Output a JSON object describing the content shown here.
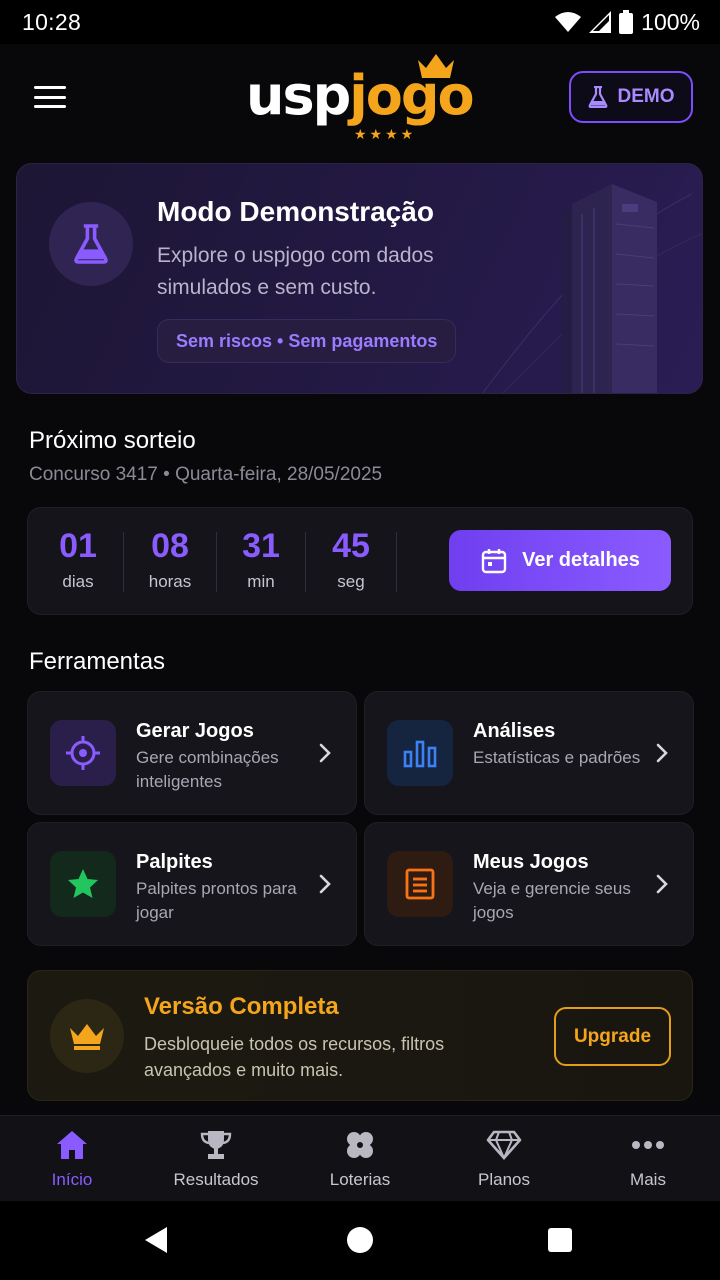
{
  "status": {
    "time": "10:28",
    "battery": "100%"
  },
  "header": {
    "logo_white": "usp",
    "logo_orange": "jogo",
    "demo_label": "DEMO"
  },
  "demo_card": {
    "title": "Modo Demonstração",
    "description": "Explore o uspjogo com dados simulados e sem custo.",
    "chip": "Sem riscos • Sem pagamentos"
  },
  "next_draw": {
    "title": "Próximo sorteio",
    "subtitle": "Concurso 3417 • Quarta-feira, 28/05/2025",
    "countdown": [
      {
        "value": "01",
        "label": "dias"
      },
      {
        "value": "08",
        "label": "horas"
      },
      {
        "value": "31",
        "label": "min"
      },
      {
        "value": "45",
        "label": "seg"
      }
    ],
    "details_button": "Ver detalhes"
  },
  "tools": {
    "title": "Ferramentas",
    "items": [
      {
        "title": "Gerar Jogos",
        "desc": "Gere combinações inteligentes",
        "icon": "target-icon",
        "color": "#8a5cff"
      },
      {
        "title": "Análises",
        "desc": "Estatísticas e padrões",
        "icon": "bar-chart-icon",
        "color": "#3b82f6"
      },
      {
        "title": "Palpites",
        "desc": "Palpites prontos para jogar",
        "icon": "star-icon",
        "color": "#22c55e"
      },
      {
        "title": "Meus Jogos",
        "desc": "Veja e gerencie seus jogos",
        "icon": "document-icon",
        "color": "#f97316"
      }
    ]
  },
  "upgrade": {
    "title": "Versão Completa",
    "description": "Desbloqueie todos os recursos, filtros avançados e muito mais.",
    "button": "Upgrade"
  },
  "bottom_nav": [
    {
      "label": "Início",
      "icon": "home-icon",
      "active": true
    },
    {
      "label": "Resultados",
      "icon": "trophy-icon",
      "active": false
    },
    {
      "label": "Loterias",
      "icon": "clover-icon",
      "active": false
    },
    {
      "label": "Planos",
      "icon": "diamond-icon",
      "active": false
    },
    {
      "label": "Mais",
      "icon": "more-icon",
      "active": false
    }
  ],
  "colors": {
    "accent": "#8a5cff",
    "gold": "#f4a51c",
    "background": "#08080b"
  }
}
